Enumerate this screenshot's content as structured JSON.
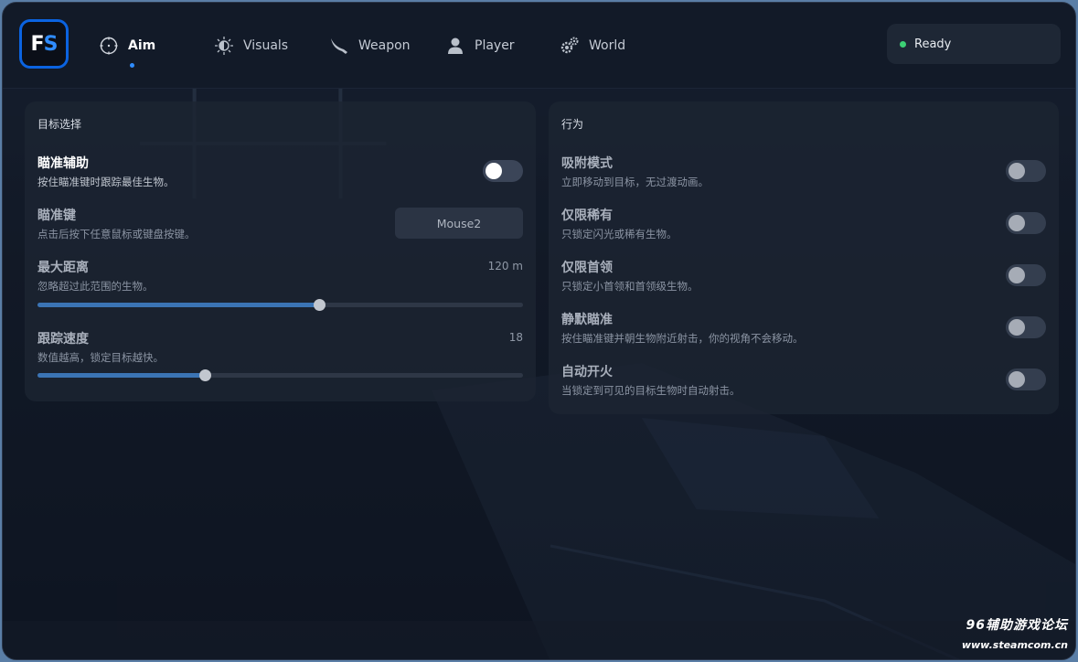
{
  "app": {
    "logo_text_f": "F",
    "logo_text_s": "S"
  },
  "tabs": [
    {
      "label": "Aim",
      "icon": "crosshair-icon",
      "active": true
    },
    {
      "label": "Visuals",
      "icon": "sun-eye-icon",
      "active": false
    },
    {
      "label": "Weapon",
      "icon": "scimitar-icon",
      "active": false
    },
    {
      "label": "Player",
      "icon": "person-icon",
      "active": false
    },
    {
      "label": "World",
      "icon": "gears-icon",
      "active": false
    }
  ],
  "status": {
    "label": "Ready",
    "color": "#3ccf74"
  },
  "target_panel": {
    "title": "目标选择",
    "aim_assist": {
      "title": "瞄准辅助",
      "desc": "按住瞄准键时跟踪最佳生物。",
      "enabled": true
    },
    "aim_key": {
      "title": "瞄准键",
      "desc": "点击后按下任意鼠标或键盘按键。",
      "value": "Mouse2"
    },
    "max_distance": {
      "title": "最大距离",
      "desc": "忽略超过此范围的生物。",
      "value": "120 m",
      "fraction": 0.58
    },
    "track_speed": {
      "title": "跟踪速度",
      "desc": "数值越高，锁定目标越快。",
      "value": "18",
      "fraction": 0.345
    }
  },
  "behavior_panel": {
    "title": "行为",
    "rows": [
      {
        "title": "吸附模式",
        "desc": "立即移动到目标，无过渡动画。",
        "enabled": false
      },
      {
        "title": "仅限稀有",
        "desc": "只锁定闪光或稀有生物。",
        "enabled": false
      },
      {
        "title": "仅限首领",
        "desc": "只锁定小首领和首领级生物。",
        "enabled": false
      },
      {
        "title": "静默瞄准",
        "desc": "按住瞄准键并朝生物附近射击，你的视角不会移动。",
        "enabled": false
      },
      {
        "title": "自动开火",
        "desc": "当锁定到可见的目标生物时自动射击。",
        "enabled": false
      }
    ]
  },
  "watermark": {
    "line1": "96辅助游戏论坛",
    "line2": "www.steamcom.cn"
  },
  "colors": {
    "accent": "#2f8cff",
    "slider_fill": "#3b74b4",
    "panel": "#1c2432"
  }
}
